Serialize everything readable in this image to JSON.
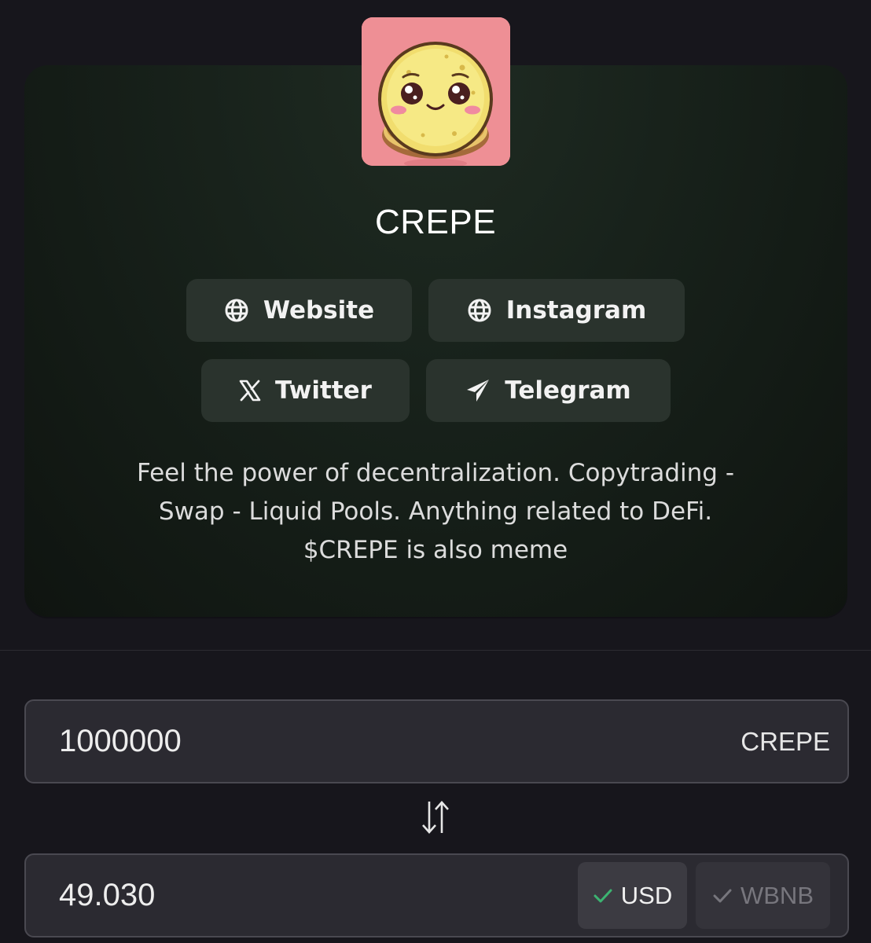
{
  "token": {
    "name": "CREPE",
    "logo_icon": "crepe-mascot-logo",
    "description": "Feel the power of decentralization. Copytrading -\nSwap - Liquid Pools. Anything related to DeFi.\n$CREPE is also meme"
  },
  "links": {
    "website": {
      "label": "Website",
      "icon": "globe-icon"
    },
    "instagram": {
      "label": "Instagram",
      "icon": "globe-icon"
    },
    "twitter": {
      "label": "Twitter",
      "icon": "x-logo-icon"
    },
    "telegram": {
      "label": "Telegram",
      "icon": "paper-plane-icon"
    }
  },
  "converter": {
    "from_value": "1000000",
    "from_unit": "CREPE",
    "to_value": "49.030",
    "swap_icon": "swap-arrows-icon",
    "units": [
      {
        "label": "USD",
        "selected": true
      },
      {
        "label": "WBNB",
        "selected": false
      }
    ]
  },
  "colors": {
    "background": "#17161c",
    "card": "#18221b",
    "button": "#2a332d",
    "field": "#2b2a31",
    "check_green": "#3cb371"
  }
}
